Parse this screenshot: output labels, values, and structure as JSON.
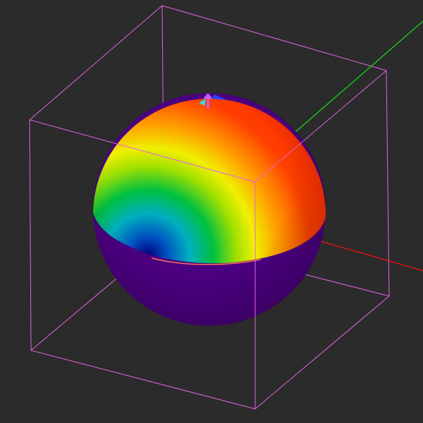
{
  "viewport": {
    "background": "#2b2b2b",
    "bounding_box_color": "#e464e4",
    "axes": {
      "x_color": "#ff1010",
      "y_color": "#10e010"
    },
    "sphere": {
      "lower_color": "#4b0080",
      "colormap": [
        "#00007a",
        "#0050c0",
        "#00b0c0",
        "#00c040",
        "#a0e000",
        "#f0f000",
        "#ffa000",
        "#ff4000",
        "#ff1a00"
      ]
    }
  }
}
